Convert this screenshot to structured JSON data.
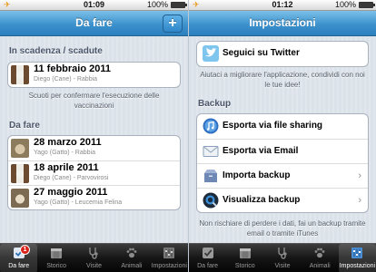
{
  "left": {
    "status": {
      "time": "01:09",
      "battery": "100%"
    },
    "nav": {
      "title": "Da fare",
      "add_label": "+"
    },
    "overdue": {
      "header": "In scadenza / scadute",
      "items": [
        {
          "date": "11 febbraio 2011",
          "detail": "Diego (Cane) - Rabbia"
        }
      ],
      "note": "Scuoti per confermare l'esecuzione delle vaccinazioni"
    },
    "todo": {
      "header": "Da fare",
      "items": [
        {
          "date": "28 marzo 2011",
          "detail": "Yago (Gatto) - Rabbia"
        },
        {
          "date": "18 aprile 2011",
          "detail": "Diego (Cane) - Parvovirosi"
        },
        {
          "date": "27 maggio 2011",
          "detail": "Yago (Gatto) - Leucemia Felina"
        }
      ]
    },
    "tabs": [
      {
        "label": "Da fare",
        "badge": "1"
      },
      {
        "label": "Storico"
      },
      {
        "label": "Visite"
      },
      {
        "label": "Animali"
      },
      {
        "label": "Impostazioni"
      }
    ]
  },
  "right": {
    "status": {
      "time": "01:12",
      "battery": "100%"
    },
    "nav": {
      "title": "Impostazioni"
    },
    "twitter": {
      "label": "Seguici su Twitter"
    },
    "twitter_note": "Aiutaci a migliorare l'applicazione, condividi con noi le tue idee!",
    "backup": {
      "header": "Backup",
      "items": [
        {
          "label": "Esporta via file sharing"
        },
        {
          "label": "Esporta via Email"
        },
        {
          "label": "Importa backup",
          "chevron": "›"
        },
        {
          "label": "Visualizza backup",
          "chevron": "›"
        }
      ],
      "note": "Non rischiare di perdere i dati, fai un backup tramite email o tramite iTunes"
    },
    "tabs": [
      {
        "label": "Da fare"
      },
      {
        "label": "Storico"
      },
      {
        "label": "Visite"
      },
      {
        "label": "Animali"
      },
      {
        "label": "Impostazioni"
      }
    ]
  },
  "colors": {
    "nav_blue": "#3d92cd",
    "badge_red": "#d8231b",
    "plane": "#e79a1c"
  },
  "icons": [
    "airplane-icon",
    "battery-icon",
    "add-icon",
    "twitter-bird-icon",
    "itunes-icon",
    "mail-icon",
    "archive-box-icon",
    "quicktime-icon",
    "checklist-icon",
    "calendar-icon",
    "stethoscope-icon",
    "paw-icon",
    "sliders-icon",
    "chevron-right-icon"
  ]
}
